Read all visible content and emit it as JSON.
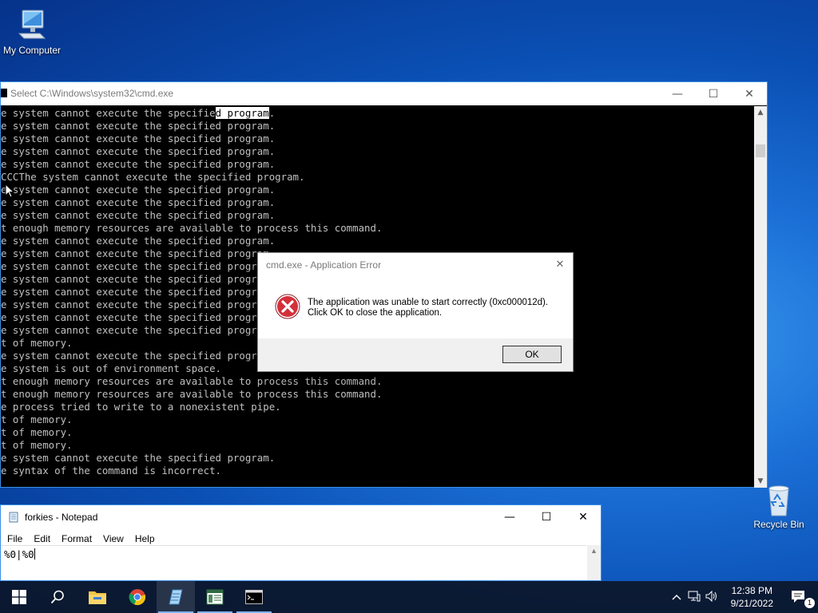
{
  "desktop": {
    "my_computer_label": "My Computer",
    "recycle_bin_label": "Recycle Bin"
  },
  "cmd_window": {
    "title": "Select C:\\Windows\\system32\\cmd.exe",
    "lines": [
      "e system cannot execute the specified program.",
      "e system cannot execute the specified program.",
      "e system cannot execute the specified program.",
      "e system cannot execute the specified program.",
      "e system cannot execute the specified program.",
      "CCCThe system cannot execute the specified program.",
      "e system cannot execute the specified program.",
      "e system cannot execute the specified program.",
      "e system cannot execute the specified program.",
      "t enough memory resources are available to process this command.",
      "e system cannot execute the specified program.",
      "e system cannot execute the specified program.",
      "e system cannot execute the specified program.",
      "e system cannot execute the specified program.",
      "e system cannot execute the specified program.",
      "e system cannot execute the specified program.",
      "e system cannot execute the specified program.",
      "e system cannot execute the specified program.",
      "t of memory.",
      "e system cannot execute the specified program.",
      "e system is out of environment space.",
      "t enough memory resources are available to process this command.",
      "t enough memory resources are available to process this command.",
      "e process tried to write to a nonexistent pipe.",
      "t of memory.",
      "t of memory.",
      "t of memory.",
      "e system cannot execute the specified program.",
      "e syntax of the command is incorrect."
    ],
    "first_line_prefix": "e system cannot execute the specifie",
    "first_line_selected": "d program",
    "first_line_suffix": "."
  },
  "error_dialog": {
    "title": "cmd.exe - Application Error",
    "message_line1": "The application was unable to start correctly (0xc000012d).",
    "message_line2": "Click OK to close the application.",
    "ok_label": "OK",
    "icon": "error-icon"
  },
  "notepad": {
    "title": "forkies - Notepad",
    "menu": [
      "File",
      "Edit",
      "Format",
      "View",
      "Help"
    ],
    "content": "%0|%0"
  },
  "taskbar": {
    "time": "12:38 PM",
    "date": "9/21/2022",
    "notification_count": "1",
    "apps": [
      "start-icon",
      "search-icon",
      "file-explorer-icon",
      "chrome-icon",
      "notepad-icon",
      "app-icon",
      "cmd-icon"
    ]
  },
  "colors": {
    "console_bg": "#000000",
    "console_text": "#c0c0c0",
    "desktop_accent": "#1b6fd6",
    "error_red": "#d3303b"
  }
}
